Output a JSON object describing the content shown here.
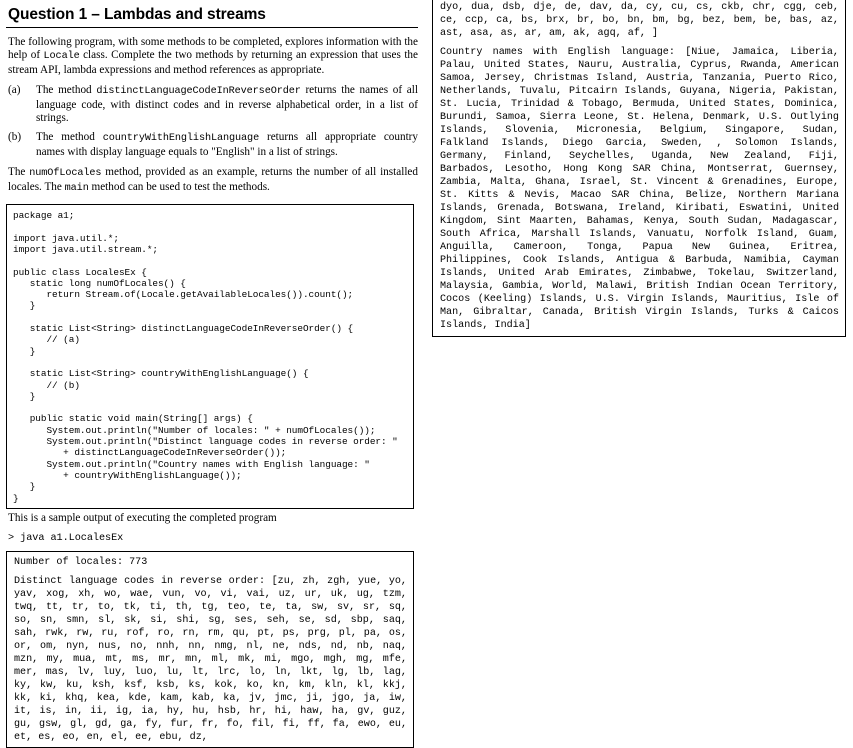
{
  "document": {
    "title": "Question 1 – Lambdas and streams",
    "intro": "The following program, with some methods to be completed, explores information with the help of Locale class. Complete the two methods by returning an expression that uses the stream API, lambda expressions and method references as appropriate.",
    "intro_parts": {
      "p1": "The following program, with some methods to be completed, explores information with the help of ",
      "code1": "Locale",
      "p2": " class. Complete the two methods by returning an expression that uses the stream API, lambda expressions and method references as appropriate."
    },
    "items": [
      {
        "marker": "(a)",
        "pre": "The method ",
        "code": "distinctLanguageCodeInReverseOrder",
        "post": " returns the names of all language code, with distinct codes and in reverse alphabetical order, in a list of strings."
      },
      {
        "marker": "(b)",
        "pre": "The method ",
        "code": "countryWithEnglishLanguage",
        "post": " returns all appropriate country names with display language equals to \"English\" in a list of strings."
      }
    ],
    "closing": {
      "p1": "The ",
      "code1": "numOfLocales",
      "p2": " method, provided as an example, returns the number of all installed locales. The ",
      "code2": "main",
      "p3": " method can be used to test the methods."
    },
    "sample_output_caption": "This is a sample output of executing the completed program",
    "shell_command": "> java a1.LocalesEx"
  },
  "code_block": {
    "language": "java",
    "source": "package a1;\n\nimport java.util.*;\nimport java.util.stream.*;\n\npublic class LocalesEx {\n   static long numOfLocales() {\n      return Stream.of(Locale.getAvailableLocales()).count();\n   }\n\n   static List<String> distinctLanguageCodeInReverseOrder() {\n      // (a)\n   }\n\n   static List<String> countryWithEnglishLanguage() {\n      // (b)\n   }\n\n   public static void main(String[] args) {\n      System.out.println(\"Number of locales: \" + numOfLocales());\n      System.out.println(\"Distinct language codes in reverse order: \"\n         + distinctLanguageCodeInReverseOrder());\n      System.out.println(\"Country names with English language: \"\n         + countryWithEnglishLanguage());\n   }\n}"
  },
  "console_output": {
    "line_locales_count": "Number of locales: 773",
    "language_codes_label": "Distinct language codes in reverse order: [zu, zh, zgh, yue, yo, yav, xog, xh, wo, wae, vun, vo, vi, vai, uz, ur, uk, ug, tzm, twq, tt, tr, to, tk, ti, th, tg, teo, te, ta, sw, sv, sr, sq, so, sn, smn, sl, sk, si, shi, sg, ses, seh, se, sd, sbp, saq, sah, rwk, rw, ru, rof, ro, rn, rm, qu, pt, ps, prg, pl, pa, os, or, om, nyn, nus, no, nnh, nn, nmg, nl, ne, nds, nd, nb, naq, mzn, my, mua, mt, ms, mr, mn, ml, mk, mi, mgo, mgh, mg, mfe, mer, mas, lv, luy, luo, lu, lt, lrc, lo, ln, lkt, lg, lb, lag, ky, kw, ku, ksh, ksf, ksb, ks, kok, ko, kn, km, kln, kl, kkj, kk, ki, khq, kea, kde, kam, kab, ka, jv, jmc, ji, jgo, ja, iw, it, is, in, ii, ig, ia, hy, hu, hsb, hr, hi, haw, ha, gv, guz, gu, gsw, gl, gd, ga, fy, fur, fr, fo, fil, fi, ff, fa, ewo, eu, et, es, eo, en, el, ee, ebu, dz,",
    "language_codes_continued": "dyo, dua, dsb, dje, de, dav, da, cy, cu, cs, ckb, chr, cgg, ceb, ce, ccp, ca, bs, brx, br, bo, bn, bm, bg, bez, bem, be, bas, az, ast, asa, as, ar, am, ak, agq, af, ]",
    "country_names": "Country names with English language: [Niue, Jamaica, Liberia, Palau, United States, Nauru, Australia, Cyprus, Rwanda, American Samoa, Jersey, Christmas Island, Austria, Tanzania, Puerto Rico, Netherlands, Tuvalu, Pitcairn Islands, Guyana, Nigeria, Pakistan, St. Lucia, Trinidad & Tobago, Bermuda, United States, Dominica, Burundi, Samoa, Sierra Leone, St. Helena, Denmark, U.S. Outlying Islands, Slovenia, Micronesia, Belgium, Singapore, Sudan, Falkland Islands, Diego Garcia, Sweden, , Solomon Islands, Germany, Finland, Seychelles, Uganda, New Zealand, Fiji, Barbados, Lesotho, Hong Kong SAR China, Montserrat, Guernsey, Zambia, Malta, Ghana, Israel, St. Vincent & Grenadines, Europe, St. Kitts & Nevis, Macao SAR China, Belize, Northern Mariana Islands, Grenada, Botswana, Ireland, Kiribati, Eswatini, United Kingdom, Sint Maarten, Bahamas, Kenya, South Sudan, Madagascar, South Africa, Marshall Islands, Vanuatu, Norfolk Island, Guam, Anguilla, Cameroon, Tonga, Papua New Guinea, Eritrea, Philippines, Cook Islands, Antigua & Barbuda, Namibia, Cayman Islands, United Arab Emirates, Zimbabwe, Tokelau, Switzerland, Malaysia, Gambia, World, Malawi, British Indian Ocean Territory, Cocos (Keeling) Islands, U.S. Virgin Islands, Mauritius, Isle of Man, Gibraltar, Canada, British Virgin Islands, Turks & Caicos Islands, India]"
  },
  "colors": {
    "text": "#000000",
    "background": "#ffffff",
    "border": "#000000"
  }
}
